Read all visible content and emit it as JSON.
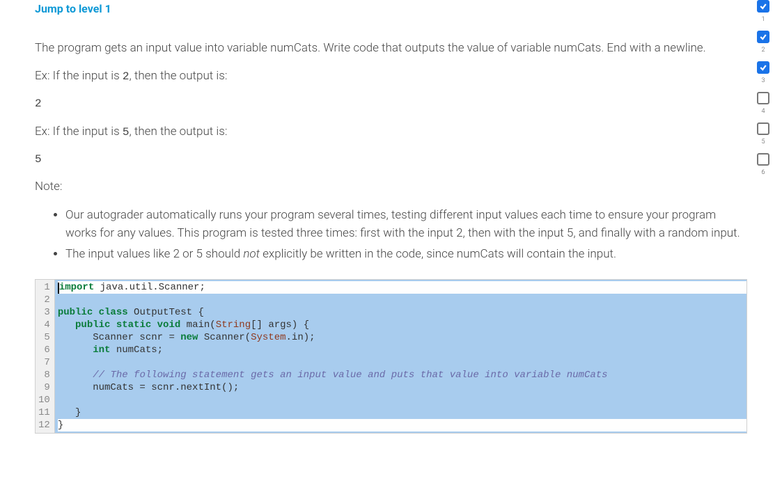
{
  "header": {
    "jump_link": "Jump to level 1"
  },
  "problem": {
    "intro": "The program gets an input value into variable numCats. Write code that outputs the value of variable numCats. End with a newline.",
    "ex1_label_pre": "Ex: If the input is ",
    "ex1_input": "2",
    "ex1_label_post": ", then the output is:",
    "ex1_output": "2",
    "ex2_label_pre": "Ex: If the input is ",
    "ex2_input": "5",
    "ex2_label_post": ", then the output is:",
    "ex2_output": "5",
    "note_label": "Note:",
    "note1": "Our autograder automatically runs your program several times, testing different input values each time to ensure your program works for any values. This program is tested three times: first with the input 2, then with the input 5, and finally with a random input.",
    "note2_pre": "The input values like 2 or 5 should ",
    "note2_em": "not",
    "note2_post": " explicitly be written in the code, since numCats will contain the input."
  },
  "progress": {
    "steps": [
      {
        "n": "1",
        "checked": true
      },
      {
        "n": "2",
        "checked": true
      },
      {
        "n": "3",
        "checked": true
      },
      {
        "n": "4",
        "checked": false
      },
      {
        "n": "5",
        "checked": false
      },
      {
        "n": "6",
        "checked": false
      }
    ]
  },
  "code": {
    "lines": [
      {
        "n": 1,
        "sel": false,
        "tokens": [
          [
            "kw",
            "import"
          ],
          [
            "punc",
            " java.util.Scanner;"
          ]
        ]
      },
      {
        "n": 2,
        "sel": true,
        "tokens": []
      },
      {
        "n": 3,
        "sel": true,
        "tokens": [
          [
            "kw",
            "public class"
          ],
          [
            "punc",
            " OutputTest {"
          ]
        ]
      },
      {
        "n": 4,
        "sel": true,
        "tokens": [
          [
            "punc",
            "   "
          ],
          [
            "kw",
            "public static void"
          ],
          [
            "punc",
            " main("
          ],
          [
            "typeStr",
            "String"
          ],
          [
            "punc",
            "[] args) {"
          ]
        ]
      },
      {
        "n": 5,
        "sel": true,
        "tokens": [
          [
            "punc",
            "      Scanner scnr = "
          ],
          [
            "kw",
            "new"
          ],
          [
            "punc",
            " Scanner("
          ],
          [
            "sys",
            "System"
          ],
          [
            "punc",
            ".in);"
          ]
        ]
      },
      {
        "n": 6,
        "sel": true,
        "tokens": [
          [
            "punc",
            "      "
          ],
          [
            "kw",
            "int"
          ],
          [
            "punc",
            " numCats;"
          ]
        ]
      },
      {
        "n": 7,
        "sel": true,
        "tokens": []
      },
      {
        "n": 8,
        "sel": true,
        "tokens": [
          [
            "punc",
            "      "
          ],
          [
            "cmnt",
            "// The following statement gets an input value and puts that value into variable numCats"
          ]
        ]
      },
      {
        "n": 9,
        "sel": true,
        "tokens": [
          [
            "punc",
            "      numCats = scnr.nextInt();"
          ]
        ]
      },
      {
        "n": 10,
        "sel": true,
        "tokens": []
      },
      {
        "n": 11,
        "sel": true,
        "tokens": [
          [
            "punc",
            "   }"
          ]
        ]
      },
      {
        "n": 12,
        "sel": false,
        "tokens": [
          [
            "punc",
            "}"
          ]
        ]
      }
    ]
  }
}
